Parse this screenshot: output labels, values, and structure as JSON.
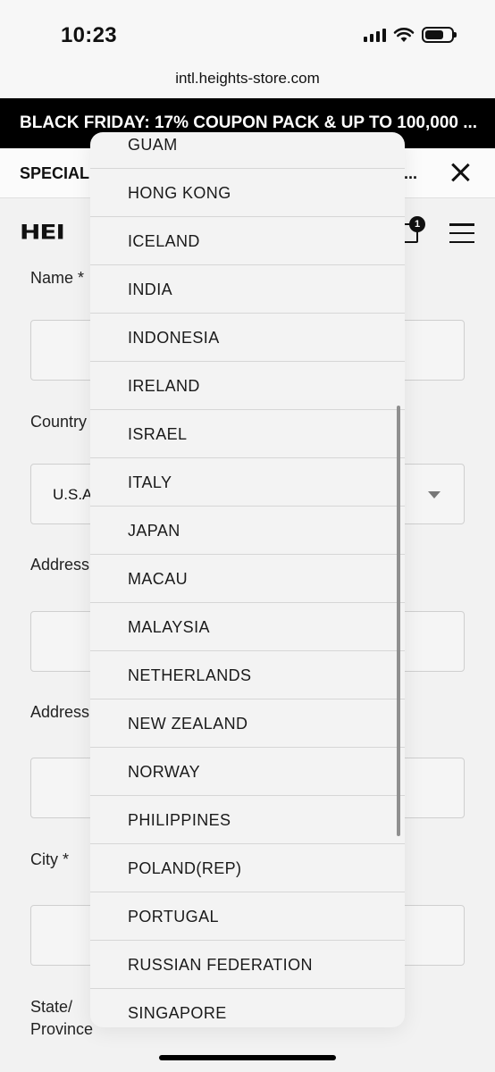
{
  "status": {
    "time": "10:23"
  },
  "url": "intl.heights-store.com",
  "promo_banner": "BLACK FRIDAY: 17% COUPON PACK & UP TO 100,000 ...",
  "special_bar": {
    "text": "SPECIAL",
    "ellipsis": "..."
  },
  "header": {
    "logo": "HEI",
    "cart_count": "1"
  },
  "form": {
    "name_label": "Name *",
    "country_label": "Country",
    "country_value": "U.S.A",
    "address1_label": "Address",
    "address2_label": "Address",
    "city_label": "City *",
    "state_label_line1": "State/",
    "state_label_line2": "Province"
  },
  "dropdown": {
    "items": [
      "GUAM",
      "HONG KONG",
      "ICELAND",
      "INDIA",
      "INDONESIA",
      "IRELAND",
      "ISRAEL",
      "ITALY",
      "JAPAN",
      "MACAU",
      "MALAYSIA",
      "NETHERLANDS",
      "NEW ZEALAND",
      "NORWAY",
      "PHILIPPINES",
      "POLAND(REP)",
      "PORTUGAL",
      "RUSSIAN FEDERATION",
      "SINGAPORE"
    ]
  },
  "icons": [
    "signal-icon",
    "wifi-icon",
    "battery-icon",
    "close-icon",
    "cart-icon",
    "menu-icon",
    "caret-down-icon"
  ]
}
